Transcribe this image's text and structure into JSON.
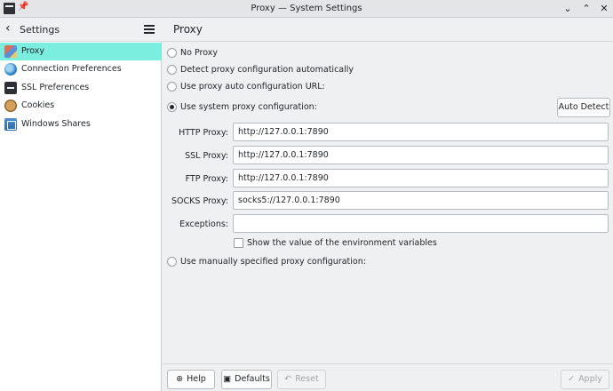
{
  "window": {
    "title": "Proxy — System Settings",
    "min_glyph": "⌄",
    "max_glyph": "⌃",
    "close_glyph": "✕",
    "pin_glyph": "📌"
  },
  "sidebar": {
    "back_glyph": "‹",
    "title": "Settings",
    "items": [
      {
        "label": "Proxy",
        "icon": "proxy-icon",
        "active": true
      },
      {
        "label": "Connection Preferences",
        "icon": "globe-icon"
      },
      {
        "label": "SSL Preferences",
        "icon": "terminal-icon"
      },
      {
        "label": "Cookies",
        "icon": "cookie-icon"
      },
      {
        "label": "Windows Shares",
        "icon": "windows-shares-icon"
      }
    ]
  },
  "main": {
    "title": "Proxy",
    "options": {
      "no_proxy": "No Proxy",
      "detect_auto": "Detect proxy configuration automatically",
      "auto_config_url": "Use proxy auto configuration URL:",
      "system_proxy": "Use system proxy configuration:",
      "manual": "Use manually specified proxy configuration:"
    },
    "selected_option": "system_proxy",
    "auto_detect_button": "Auto Detect",
    "fields": {
      "http_label": "HTTP Proxy:",
      "http_value": "http://127.0.0.1:7890",
      "ssl_label": "SSL Proxy:",
      "ssl_value": "http://127.0.0.1:7890",
      "ftp_label": "FTP Proxy:",
      "ftp_value": "http://127.0.0.1:7890",
      "socks_label": "SOCKS Proxy:",
      "socks_value": "socks5://127.0.0.1:7890",
      "exceptions_label": "Exceptions:",
      "exceptions_value": ""
    },
    "show_env_vars_label": "Show the value of the environment variables",
    "show_env_vars_checked": false
  },
  "footer": {
    "help": "Help",
    "help_glyph": "⊕",
    "defaults": "Defaults",
    "defaults_glyph": "▣",
    "reset": "Reset",
    "reset_glyph": "↶",
    "apply": "Apply",
    "apply_glyph": "✓"
  },
  "colors": {
    "accent_selection": "#7ceee0",
    "window_bg": "#eff0f1",
    "text": "#232629"
  }
}
